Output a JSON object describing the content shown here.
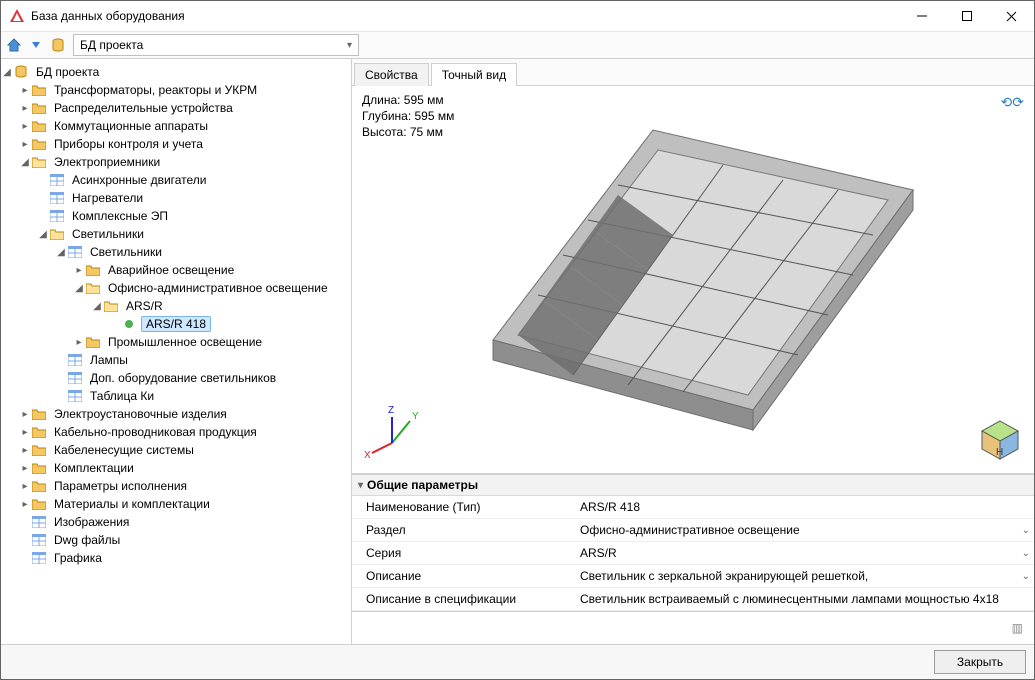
{
  "window": {
    "title": "База данных оборудования"
  },
  "toolbar": {
    "db_label": "БД проекта"
  },
  "tabs": {
    "properties": "Свойства",
    "exact_view": "Точный вид"
  },
  "dims": {
    "length": "Длина: 595 мм",
    "depth": "Глубина: 595 мм",
    "height": "Высота: 75 мм"
  },
  "params": {
    "header": "Общие параметры",
    "rows": [
      {
        "k": "Наименование (Тип)",
        "v": "ARS/R 418",
        "dd": false
      },
      {
        "k": "Раздел",
        "v": "Офисно-административное освещение",
        "dd": true
      },
      {
        "k": "Серия",
        "v": "ARS/R",
        "dd": true
      },
      {
        "k": "Описание",
        "v": "Светильник с зеркальной экранирующей решеткой,",
        "dd": true
      },
      {
        "k": "Описание в спецификации",
        "v": "Светильник встраиваемый с люминесцентными лампами мощностью 4х18",
        "dd": false
      }
    ]
  },
  "tree": {
    "root": "БД проекта",
    "n0": "Трансформаторы, реакторы и УКРМ",
    "n1": "Распределительные устройства",
    "n2": "Коммутационные аппараты",
    "n3": "Приборы контроля и учета",
    "n4": "Электроприемники",
    "n4a": "Асинхронные двигатели",
    "n4b": "Нагреватели",
    "n4c": "Комплексные ЭП",
    "n4d": "Светильники",
    "n4d1": "Светильники",
    "n4d1a": "Аварийное освещение",
    "n4d1b": "Офисно-административное освещение",
    "n4d1b1": "ARS/R",
    "n4d1b1a": "ARS/R 418",
    "n4d1c": "Промышленное освещение",
    "n4d2": "Лампы",
    "n4d3": "Доп. оборудование светильников",
    "n4d4": "Таблица Ки",
    "n5": "Электроустановочные изделия",
    "n6": "Кабельно-проводниковая продукция",
    "n7": "Кабеленесущие системы",
    "n8": "Комплектации",
    "n9": "Параметры исполнения",
    "n10": "Материалы и комплектации",
    "n11": "Изображения",
    "n12": "Dwg файлы",
    "n13": "Графика"
  },
  "footer": {
    "close": "Закрыть"
  },
  "icons": {
    "folder_color": "#f4c762",
    "table_color": "#7aa7e8"
  }
}
